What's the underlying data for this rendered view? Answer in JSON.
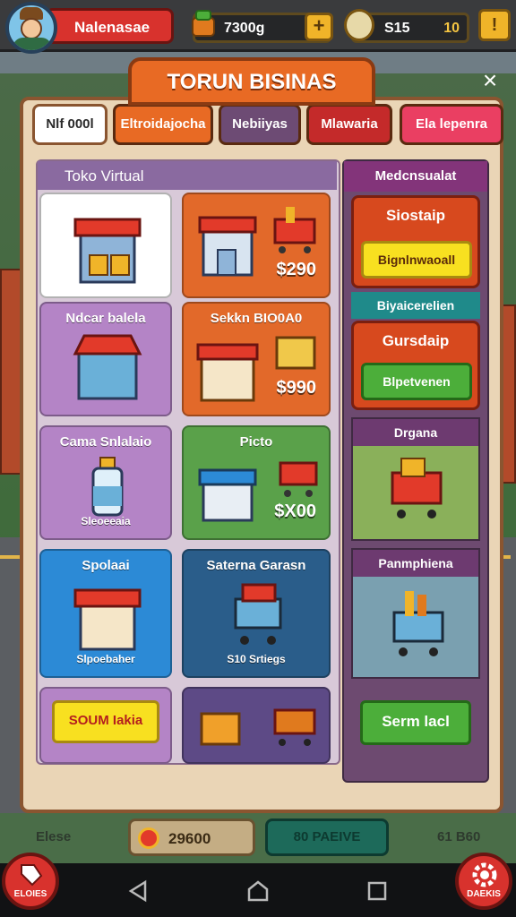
{
  "hud": {
    "player_name": "Nalenasae",
    "coins": "7300g",
    "plus_label": "+",
    "gems": "S15",
    "level": "10",
    "lock_label": "!"
  },
  "panel": {
    "title": "TORUN BISINAS",
    "close_label": "×",
    "tabs": [
      {
        "label": "Nlf 000l"
      },
      {
        "label": "Eltroidajocha"
      },
      {
        "label": "Nebiiyas"
      },
      {
        "label": "Mlawaria"
      },
      {
        "label": "Ela lepenra"
      }
    ],
    "grid_title": "Toko Virtual",
    "cards": [
      {
        "label": "",
        "price": "",
        "sub": ""
      },
      {
        "label": "",
        "price": "$290",
        "sub": ""
      },
      {
        "label": "Ndcar balela",
        "price": "",
        "sub": ""
      },
      {
        "label": "Sekkn BIO0A0",
        "price": "$990",
        "sub": ""
      },
      {
        "label": "Cama Snlalaio",
        "price": "",
        "sub": "Sleoeeaia"
      },
      {
        "label": "Picto",
        "price": "$X00",
        "sub": ""
      },
      {
        "label": "Spolaai",
        "price": "",
        "sub": "Slpoebaher"
      },
      {
        "label": "Saterna Garasn",
        "price": "",
        "sub": "S10 Srtiegs"
      },
      {
        "label": "",
        "price": "",
        "sub": ""
      },
      {
        "label": "",
        "price": "",
        "sub": ""
      }
    ],
    "yellow_button": "SOUM Iakia",
    "side": {
      "header": "Medcnsualat",
      "box1_title": "Siostaip",
      "box1_button": "Bignlnwaoall",
      "sub_header": "Biyaicerelien",
      "box2_title": "Gursdaip",
      "box2_button": "Blpetvenen",
      "img1_title": "Drgana",
      "img2_title": "Panmphiena",
      "green_button": "Serm lacl"
    }
  },
  "bottom": {
    "left_text": "Elese",
    "money": "29600",
    "mid_text": "80 PAEIVE",
    "right_text": "61 B60",
    "left_round_label": "ELOIES",
    "right_round_label": "DAEKIS"
  },
  "colors": {
    "accent_orange": "#e86a24",
    "panel_bg": "#ead5b6",
    "red": "#d8322d",
    "yellow": "#f8e020",
    "green": "#4cae3a"
  }
}
